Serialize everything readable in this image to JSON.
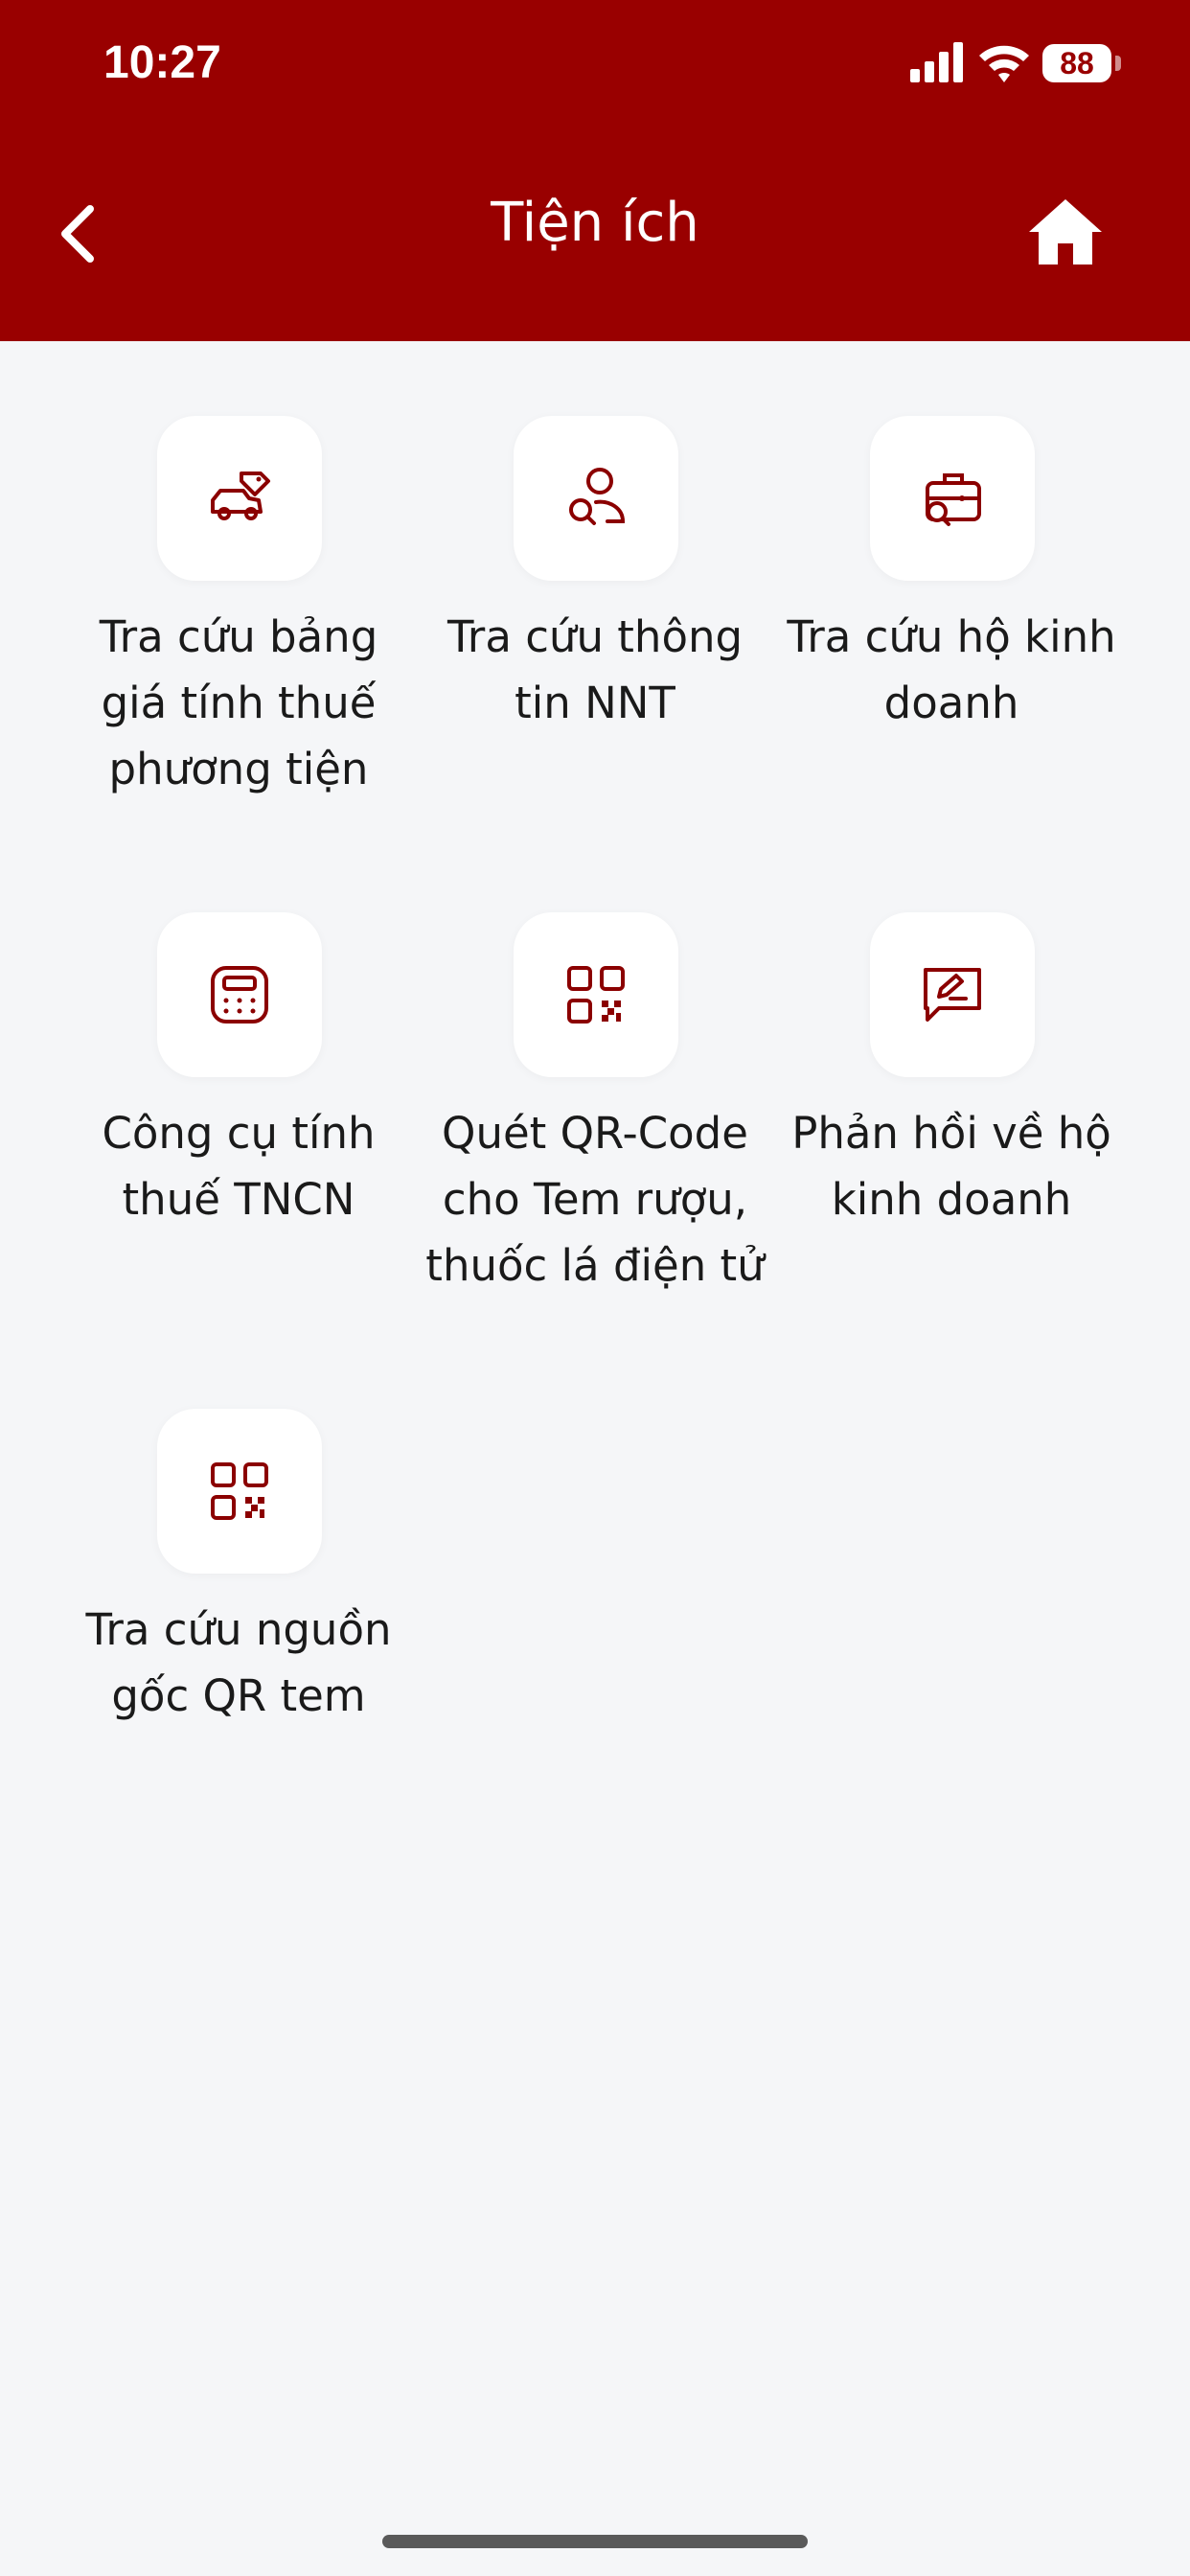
{
  "status_bar": {
    "time": "10:27",
    "battery": "88"
  },
  "header": {
    "title": "Tiện ích",
    "back_icon": "chevron-left-icon",
    "home_icon": "home-icon"
  },
  "colors": {
    "brand": "#990000",
    "background": "#f5f6f8",
    "icon": "#8b0000"
  },
  "tiles": [
    {
      "label": "Tra cứu bảng giá tính thuế phương tiện",
      "icon": "car-tag-icon"
    },
    {
      "label": "Tra cứu thông tin NNT",
      "icon": "user-search-icon"
    },
    {
      "label": "Tra cứu hộ kinh doanh",
      "icon": "briefcase-search-icon"
    },
    {
      "label": "Công cụ tính thuế TNCN",
      "icon": "calculator-icon"
    },
    {
      "label": "Quét QR-Code cho Tem rượu, thuốc lá điện tử",
      "icon": "qr-code-icon"
    },
    {
      "label": "Phản hồi về hộ kinh doanh",
      "icon": "feedback-edit-icon"
    },
    {
      "label": "Tra cứu nguồn gốc QR tem",
      "icon": "qr-code-icon"
    }
  ]
}
